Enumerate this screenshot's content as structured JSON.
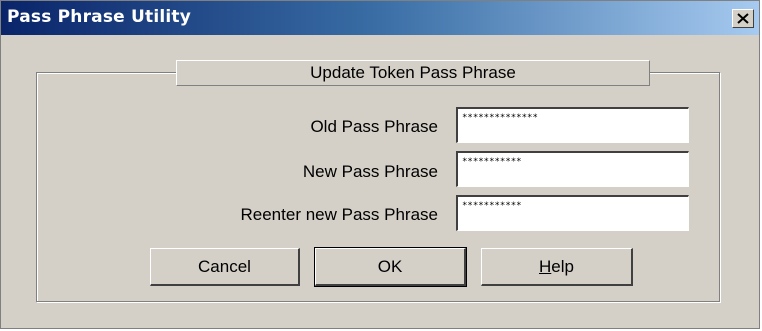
{
  "window": {
    "title": "Pass Phrase Utility",
    "close_glyph": "✕"
  },
  "group": {
    "title": "Update Token Pass Phrase"
  },
  "fields": [
    {
      "label": "Old Pass Phrase",
      "value": "**************"
    },
    {
      "label": "New Pass Phrase",
      "value": "***********"
    },
    {
      "label": "Reenter new Pass Phrase",
      "value": "***********"
    }
  ],
  "buttons": {
    "cancel": "Cancel",
    "ok": "OK",
    "help_mnemonic": "H",
    "help_rest": "elp"
  },
  "colors": {
    "window_bg": "#d4d0c8",
    "titlebar_start": "#0a246a",
    "titlebar_end": "#a6caf0"
  },
  "icons": {
    "close": "close-icon"
  }
}
